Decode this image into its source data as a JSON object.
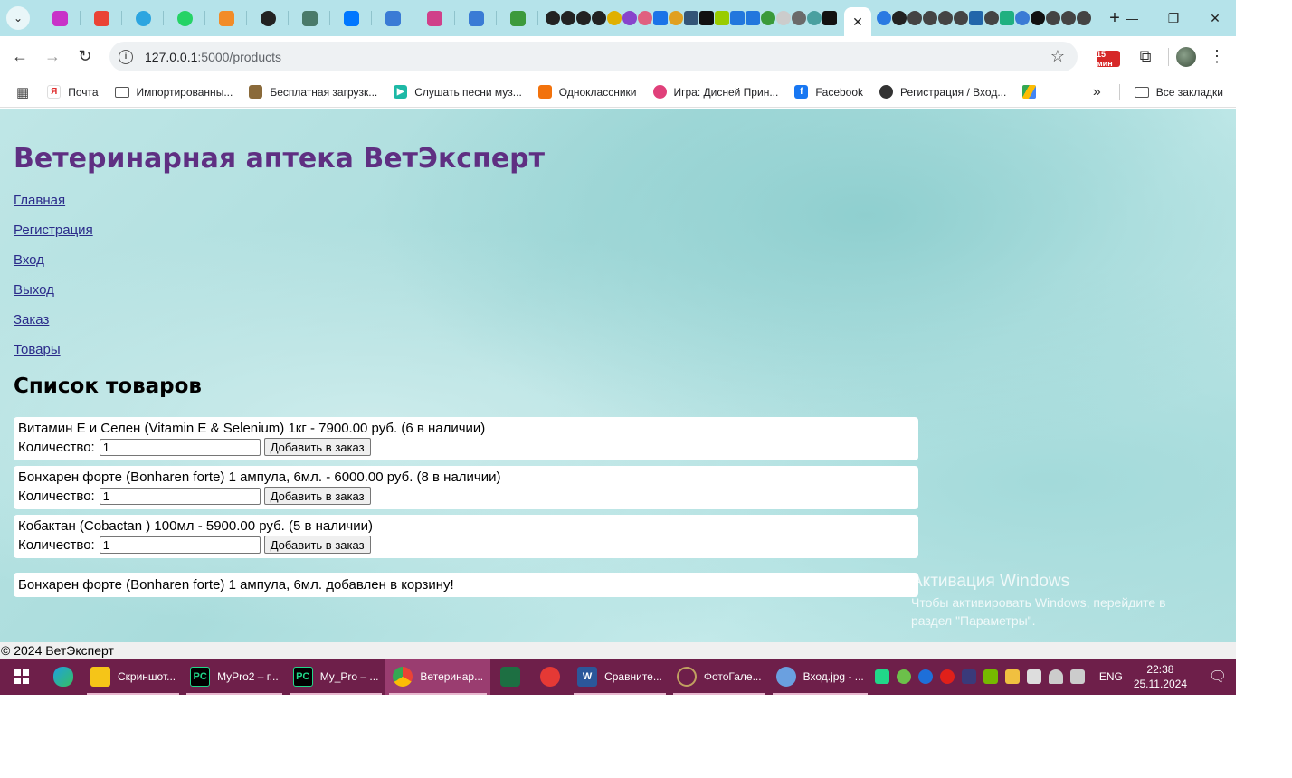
{
  "browser": {
    "url_host": "127.0.0.1",
    "url_path": ":5000/products",
    "ext_badge": "15 мин",
    "bookmarks": [
      {
        "label": "Почта",
        "color": "#ffffff"
      },
      {
        "label": "Импортированны...",
        "color": "#ffffff"
      },
      {
        "label": "Бесплатная загрузк...",
        "color": "#8a6a3a"
      },
      {
        "label": "Слушать песни муз...",
        "color": "#1db9a6"
      },
      {
        "label": "Одноклассники",
        "color": "#f2720c"
      },
      {
        "label": "Игра: Дисней Прин...",
        "color": "#e0407a"
      },
      {
        "label": "Facebook",
        "color": "#1877f2"
      },
      {
        "label": "Регистрация / Вход...",
        "color": "#333333"
      }
    ],
    "all_bookmarks": "Все закладки"
  },
  "site": {
    "title": "Ветеринарная аптека ВетЭксперт",
    "nav": [
      {
        "label": "Главная"
      },
      {
        "label": "Регистрация"
      },
      {
        "label": "Вход"
      },
      {
        "label": "Выход"
      },
      {
        "label": "Заказ"
      },
      {
        "label": "Товары"
      }
    ],
    "section_title": "Список товаров",
    "qty_label": "Количество:",
    "add_button": "Добавить в заказ",
    "products": [
      {
        "text": "Витамин Е и Селен (Vitamin E & Selenium) 1кг - 7900.00 руб. (6 в наличии)",
        "qty": "1"
      },
      {
        "text": "Бонхарен форте (Bonharen forte) 1 ампула, 6мл. - 6000.00 руб. (8 в наличии)",
        "qty": "1"
      },
      {
        "text": "Кобактан (Cobactan ) 100мл - 5900.00 руб. (5 в наличии)",
        "qty": "1"
      }
    ],
    "flash": "Бонхарен форте (Bonharen forte) 1 ампула, 6мл. добавлен в корзину!",
    "footer": "© 2024 ВетЭксперт"
  },
  "activation": {
    "title": "Активация Windows",
    "line1": "Чтобы активировать Windows, перейдите в",
    "line2": "раздел \"Параметры\"."
  },
  "taskbar": {
    "items": [
      {
        "label": "Скриншот...",
        "icon_color": "#f5c518"
      },
      {
        "label": "MyPro2 – г...",
        "icon_color": "#21d789"
      },
      {
        "label": "My_Pro – ...",
        "icon_color": "#21d789"
      },
      {
        "label": "Ветеринар...",
        "icon_color": "#ea4335"
      },
      {
        "label": "Сравните...",
        "icon_color": "#2b579a"
      },
      {
        "label": "ФотоГале...",
        "icon_color": "#c0a060"
      },
      {
        "label": "Вход.jpg - ...",
        "icon_color": "#6aa0e0"
      }
    ],
    "lang": "ENG",
    "time": "22:38",
    "date": "25.11.2024"
  }
}
